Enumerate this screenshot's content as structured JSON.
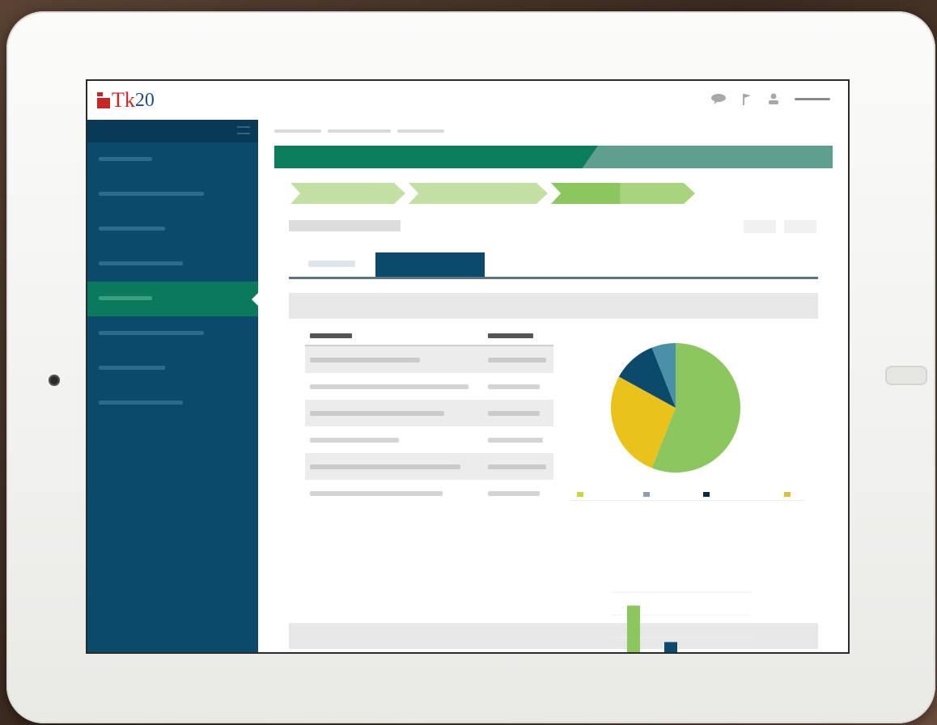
{
  "app": {
    "logo_prefix": "Tk",
    "logo_number": "20"
  },
  "icons": {
    "messages": "chat-bubble-icon",
    "pin": "flag-icon",
    "user": "user-icon",
    "menu": "hamburger-icon"
  },
  "colors": {
    "brand_red": "#c62828",
    "sidebar": "#0c4a6b",
    "sidebar_active": "#0b7a5c",
    "banner": "#0a7d5d",
    "step_light": "#c2e0a4",
    "step_active": "#8cc65e",
    "pie_green": "#8cc65e",
    "pie_yellow": "#e9c21b",
    "pie_navy": "#0c4a6b",
    "pie_teal": "#4a90a8"
  },
  "sidebar": {
    "item_count": 8,
    "active_index": 4
  },
  "workflow": {
    "steps": 3,
    "active_step": 3
  },
  "tabs": {
    "count": 2,
    "active_index": 1
  },
  "chart_data": [
    {
      "type": "pie",
      "slices": [
        {
          "color": "#8cc65e",
          "value": 0.56
        },
        {
          "color": "#e9c21b",
          "value": 0.27
        },
        {
          "color": "#0c4a6b",
          "value": 0.11
        },
        {
          "color": "#4a90a8",
          "value": 0.06
        }
      ]
    },
    {
      "type": "bar",
      "series": [
        {
          "color": "#8cc65e",
          "values": [
            0.8
          ]
        },
        {
          "color": "#0c4a6b",
          "values": [
            0.25
          ]
        }
      ]
    }
  ]
}
